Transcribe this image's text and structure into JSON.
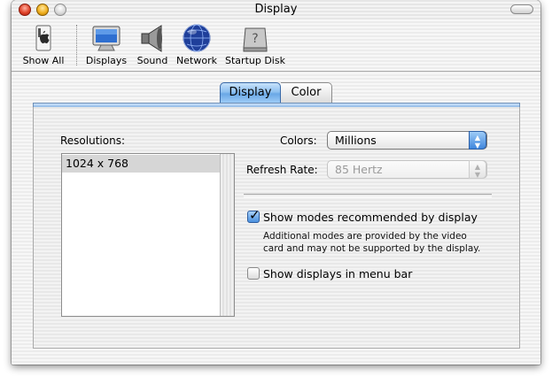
{
  "window": {
    "title": "Display"
  },
  "toolbar": {
    "items": [
      {
        "label": "Show All",
        "icon": "apple-switch-icon"
      },
      {
        "label": "Displays",
        "icon": "monitor-icon"
      },
      {
        "label": "Sound",
        "icon": "speaker-icon"
      },
      {
        "label": "Network",
        "icon": "globe-icon"
      },
      {
        "label": "Startup Disk",
        "icon": "disk-icon"
      }
    ]
  },
  "tabs": [
    {
      "label": "Display",
      "selected": true
    },
    {
      "label": "Color",
      "selected": false
    }
  ],
  "display_pane": {
    "resolutions_label": "Resolutions:",
    "resolutions": [
      "1024 x 768"
    ],
    "selected_resolution": "1024 x 768",
    "colors_label": "Colors:",
    "colors_value": "Millions",
    "refresh_label": "Refresh Rate:",
    "refresh_value": "85 Hertz",
    "refresh_enabled": false,
    "recommended_modes": {
      "label": "Show modes recommended by display",
      "checked": true
    },
    "recommended_hint_line1": "Additional modes are provided by the video",
    "recommended_hint_line2": "card and may not be supported by the display.",
    "menu_bar": {
      "label": "Show displays in menu bar",
      "checked": false
    }
  },
  "colors": {
    "accent": "#4a90de",
    "tab_active": "#8ec0f0"
  }
}
